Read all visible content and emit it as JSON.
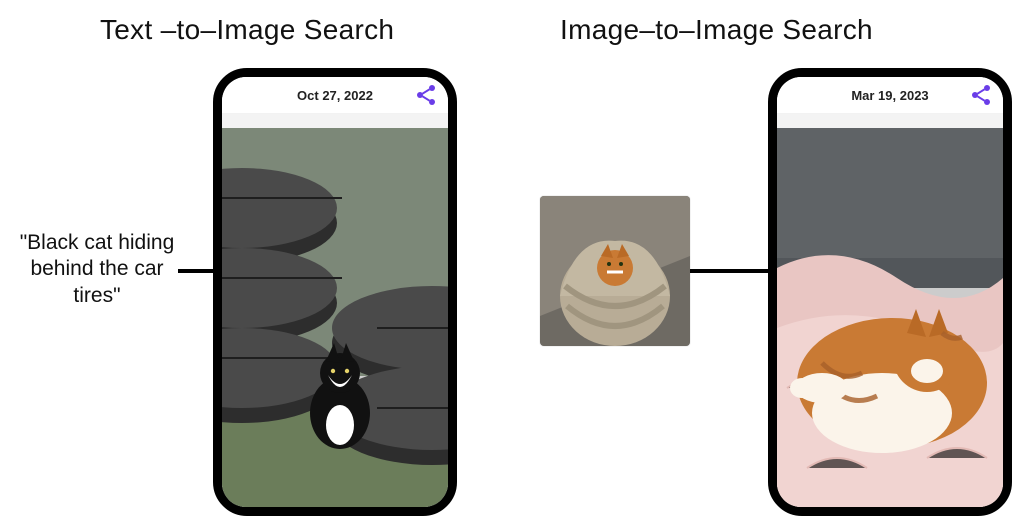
{
  "headings": {
    "text_to_image": "Text –to–Image Search",
    "image_to_image": "Image–to–Image Search"
  },
  "left": {
    "query_text": "\"Black cat hiding behind the car tires\"",
    "phone_date": "Oct 27, 2022",
    "share_icon": "share-icon",
    "result_image_caption": "black-cat-behind-tires"
  },
  "right": {
    "query_image_caption": "cat-wrapped-in-blanket",
    "phone_date": "Mar 19, 2023",
    "share_icon": "share-icon",
    "result_image_caption": "orange-cat-on-pink-blanket"
  },
  "colors": {
    "accent_share": "#6A3DE8",
    "phone_frame": "#000000",
    "tire_dark": "#2d2d2d",
    "tire_mid": "#4a4a4a",
    "floor_green": "#6b7d5a",
    "cat_black": "#111111",
    "cat_orange": "#c97a34",
    "blanket_sand": "#b8ac96",
    "blanket_pink": "#e9c6c3",
    "couch_grey": "#5f6366"
  }
}
